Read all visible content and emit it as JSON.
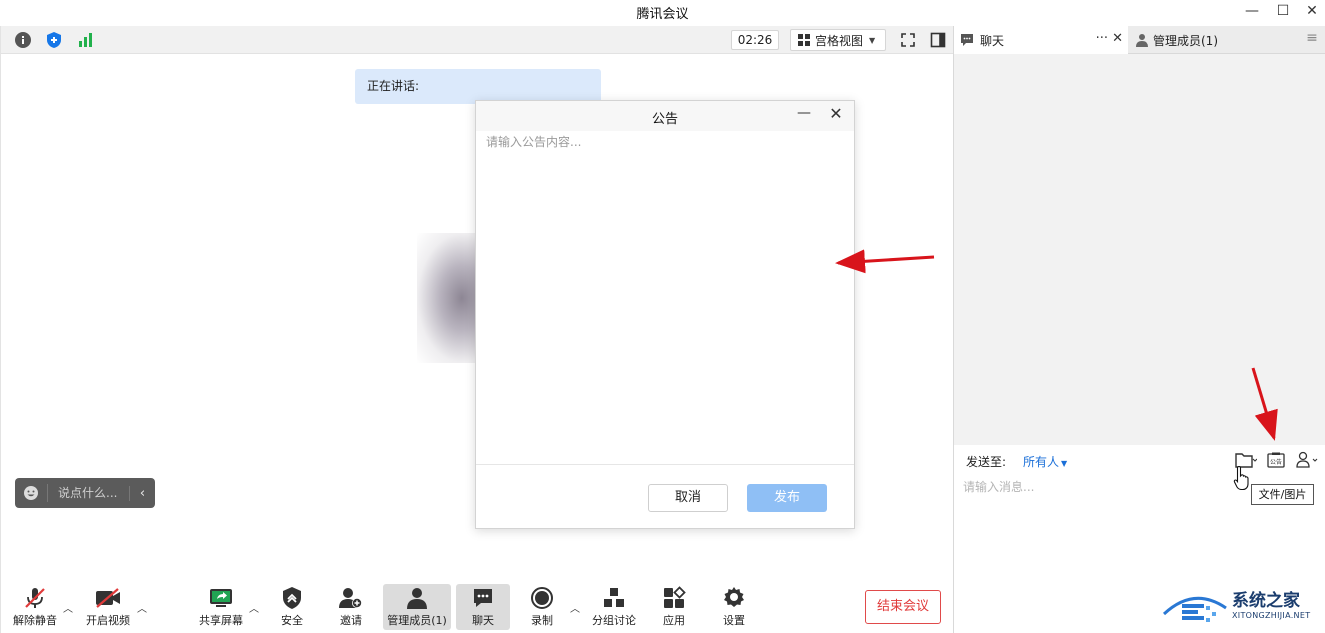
{
  "window": {
    "title": "腾讯会议",
    "minimize": "—",
    "maximize": "☐",
    "close": "✕"
  },
  "topbar": {
    "timer": "02:26",
    "grid_view_label": "宫格视图"
  },
  "main": {
    "speaking_label": "正在讲话:",
    "chat_quick_placeholder": "说点什么...",
    "chat_quick_collapse": "‹"
  },
  "dialog": {
    "title": "公告",
    "minimize": "—",
    "close": "✕",
    "textarea_placeholder": "请输入公告内容...",
    "cancel_label": "取消",
    "publish_label": "发布"
  },
  "toolbar": {
    "unmute_label": "解除静音",
    "start_video_label": "开启视频",
    "share_screen_label": "共享屏幕",
    "security_label": "安全",
    "invite_label": "邀请",
    "manage_members_label": "管理成员(1)",
    "chat_label": "聊天",
    "record_label": "录制",
    "breakout_label": "分组讨论",
    "apps_label": "应用",
    "settings_label": "设置",
    "end_meeting_label": "结束会议"
  },
  "side": {
    "chat_tab_label": "聊天",
    "chat_tab_more": "···",
    "chat_tab_close": "✕",
    "members_tab_label": "管理成员(1)",
    "send_to_label": "发送至:",
    "send_to_value": "所有人",
    "message_placeholder": "请输入消息...",
    "announcement_icon_text": "公告",
    "tooltip": "文件/图片"
  },
  "watermark": {
    "brand": "系统之家",
    "domain": "XITONGZHIJIA.NET"
  },
  "colors": {
    "accent_blue": "#1a6fd8",
    "publish_disabled": "#8fbff5",
    "end_meeting_red": "#e03a3a",
    "annotation_arrow": "#d8141b"
  }
}
